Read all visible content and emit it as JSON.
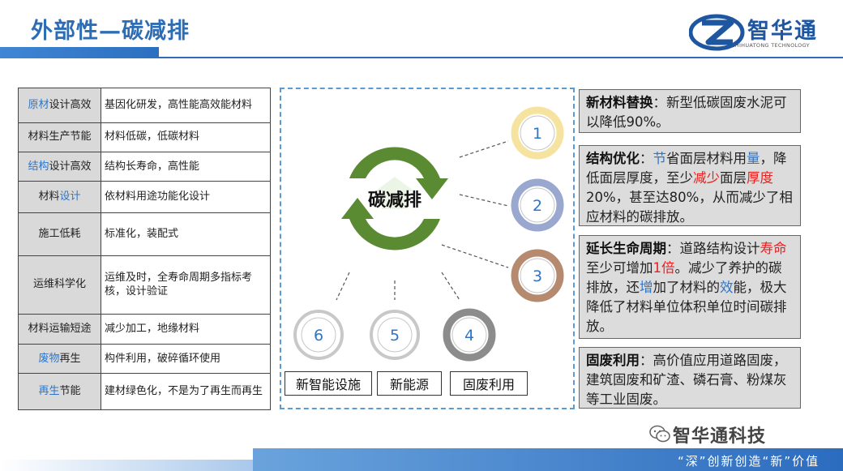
{
  "header": {
    "title": "外部性—碳减排",
    "logo_text": "智华通",
    "logo_sub": "ZHIHUATONG TECHNOLOGY"
  },
  "table": {
    "rows": [
      {
        "col1": [
          {
            "t": "原材",
            "blue": true
          },
          {
            "t": "设计高效",
            "blue": false
          }
        ],
        "col2": "基因化研发，高性能高效能材料"
      },
      {
        "col1": [
          {
            "t": "材料生产节能",
            "blue": false
          }
        ],
        "col2": "材料低碳，低碳材料"
      },
      {
        "col1": [
          {
            "t": "结构",
            "blue": true
          },
          {
            "t": "设计高效",
            "blue": false
          }
        ],
        "col2": "结构长寿命，高性能"
      },
      {
        "col1": [
          {
            "t": "材料",
            "blue": false
          },
          {
            "t": "设计",
            "blue": true
          }
        ],
        "col2": "依材料用途功能化设计"
      },
      {
        "col1": [
          {
            "t": "施工低耗",
            "blue": false
          }
        ],
        "col2": "标准化，装配式"
      },
      {
        "col1": [
          {
            "t": "运维科学化",
            "blue": false
          }
        ],
        "col2": "运维及时，全寿命周期多指标考核，设计验证"
      },
      {
        "col1": [
          {
            "t": "材料运输短途",
            "blue": false
          }
        ],
        "col2": "减少加工，地缘材料"
      },
      {
        "col1": [
          {
            "t": "废物",
            "blue": true
          },
          {
            "t": "再生",
            "blue": false
          }
        ],
        "col2": "构件利用，破碎循环使用"
      },
      {
        "col1": [
          {
            "t": "再生",
            "blue": true
          },
          {
            "t": "节能",
            "blue": false
          }
        ],
        "col2": "建材绿色化，不是为了再生而再生"
      }
    ]
  },
  "diagram": {
    "center": "碳减排",
    "circles": [
      "1",
      "2",
      "3",
      "4",
      "5",
      "6"
    ],
    "colors": {
      "arrow": "#5a8a32",
      "ring1": "#f6e3a0",
      "ring2": "#9aa8cf",
      "ring3": "#b58a6e",
      "ring4": "#8c8c8c",
      "ring56": "#c8c8c8",
      "frame": "#5b9bd5"
    },
    "tags": [
      "新智能设施",
      "新能源",
      "固废利用"
    ]
  },
  "right_boxes": [
    [
      {
        "t": "新材料",
        "c": "b"
      },
      {
        "t": "替换",
        "c": "bb"
      },
      {
        "t": "：新型低碳固废水泥可以降低90%。",
        "c": ""
      }
    ],
    [
      {
        "t": "结构优化",
        "c": "b"
      },
      {
        "t": "：",
        "c": ""
      },
      {
        "t": "节",
        "c": "blue"
      },
      {
        "t": "省面层材料用",
        "c": ""
      },
      {
        "t": "量",
        "c": "blue"
      },
      {
        "t": "，降低面层厚度，至少",
        "c": ""
      },
      {
        "t": "减少",
        "c": "red"
      },
      {
        "t": "面层",
        "c": ""
      },
      {
        "t": "厚度",
        "c": "red"
      },
      {
        "t": "20%，甚至达80%，从而减少了相应材料的碳排放。",
        "c": ""
      }
    ],
    [
      {
        "t": "延长生命周期",
        "c": "b"
      },
      {
        "t": "：道路结构设计",
        "c": ""
      },
      {
        "t": "寿命",
        "c": "red"
      },
      {
        "t": "至少可增加",
        "c": ""
      },
      {
        "t": "1倍",
        "c": "red"
      },
      {
        "t": "。减少了养护的碳排放，还",
        "c": ""
      },
      {
        "t": "增",
        "c": "blue"
      },
      {
        "t": "加了材料的",
        "c": ""
      },
      {
        "t": "效",
        "c": "blue"
      },
      {
        "t": "能，极大降低了材料单位体积单位时间碳排放。",
        "c": ""
      }
    ],
    [
      {
        "t": "固废利用",
        "c": "b"
      },
      {
        "t": "：高价值应用道路固废，建筑固废和矿渣、磷石膏、粉煤灰等工业固废。",
        "c": ""
      }
    ]
  ],
  "footer": {
    "watermark": "智华通科技",
    "slogan": "“深”创新创造“新”价值"
  }
}
